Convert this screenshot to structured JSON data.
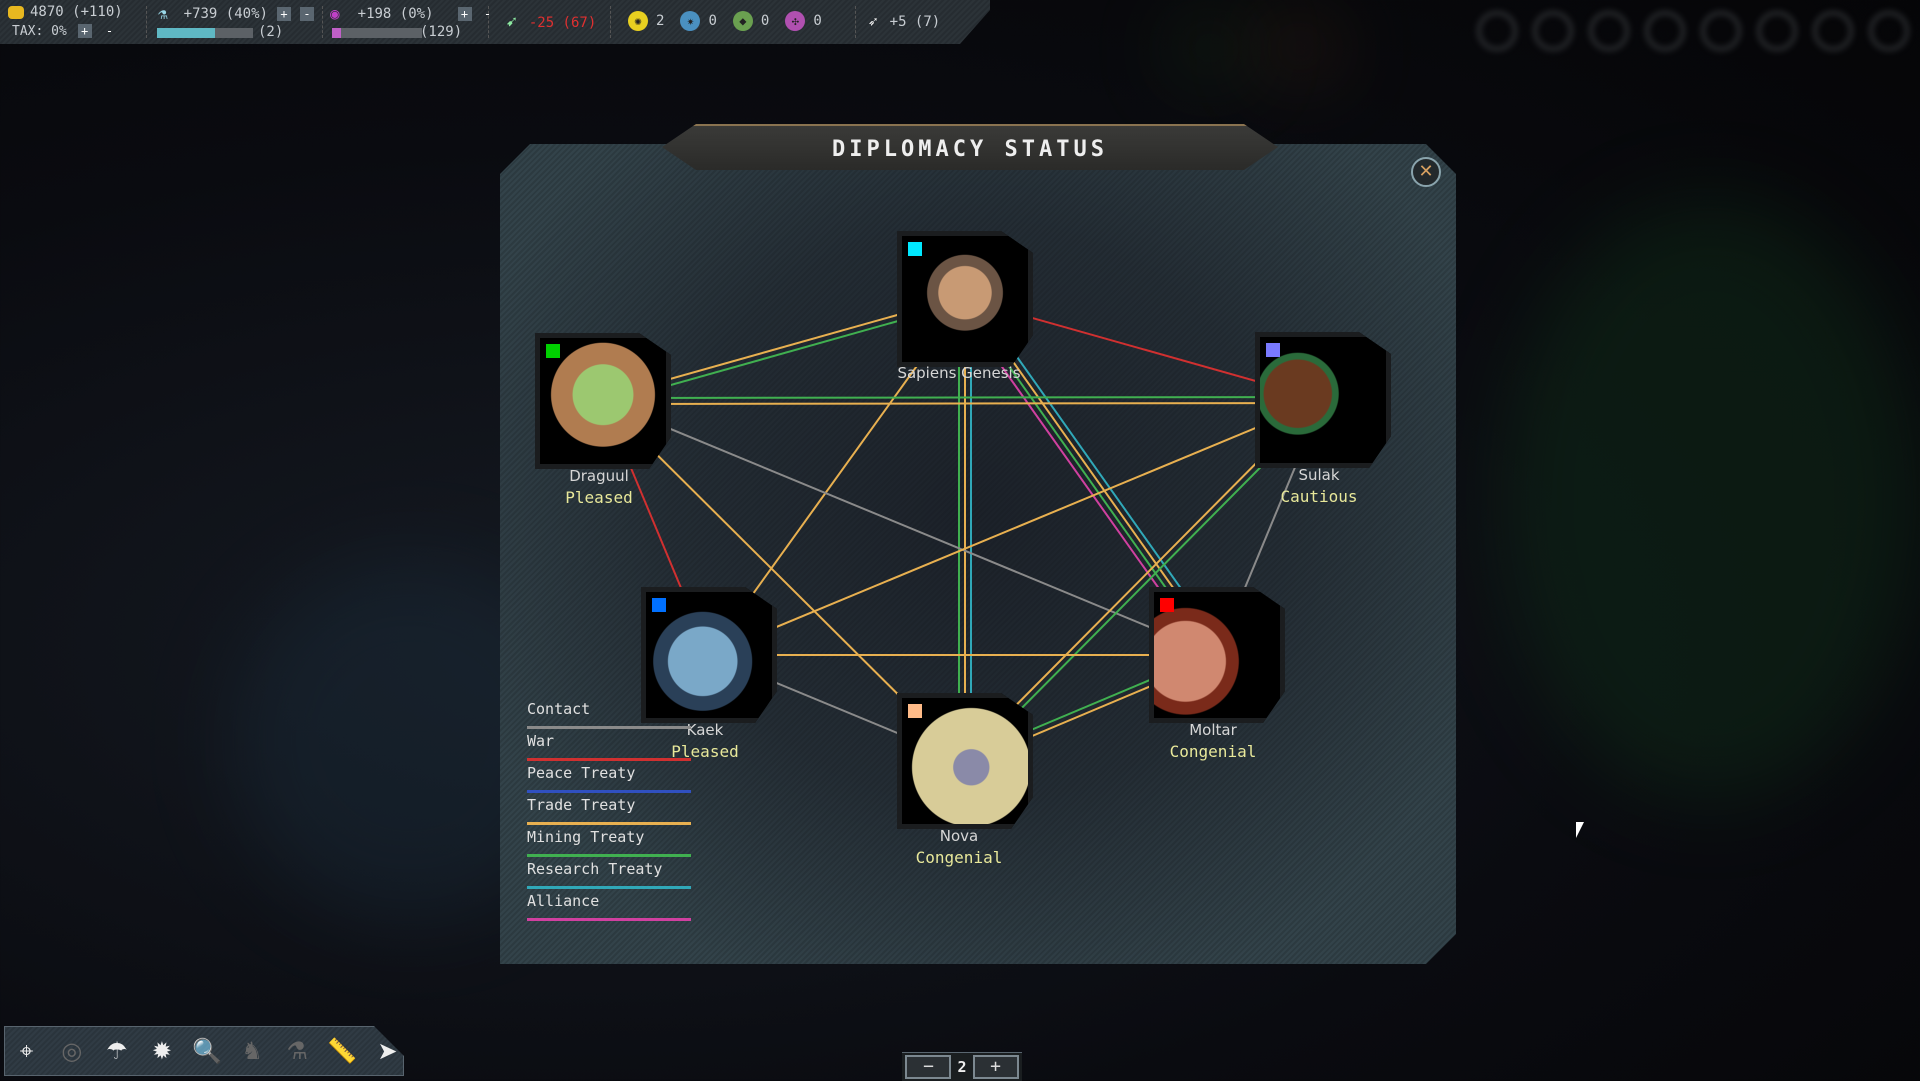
{
  "topbar": {
    "credits": {
      "icon": "credits-coin-icon",
      "value": "4870 (+110)",
      "tax_label": "TAX:",
      "tax_value": "0%",
      "plus": "+",
      "minus": "-"
    },
    "research": {
      "icon": "research-flask-icon",
      "value": "+739 (40%)",
      "count": "(2)",
      "progress": 0.6,
      "plus": "+",
      "minus": "-",
      "color": "#5fb8c4"
    },
    "influence": {
      "icon": "influence-icon",
      "value": "+198 (0%)",
      "count": "(129)",
      "progress": 0.1,
      "plus": "+",
      "minus": "-",
      "color": "#c060c8"
    },
    "command": {
      "icon": "command-ship-icon",
      "value": "-25 (67)",
      "color": "#e03030"
    },
    "strategic": [
      {
        "icon": "atom-resource-icon",
        "value": "2",
        "color": "#e8d020"
      },
      {
        "icon": "crystal-burst-resource-icon",
        "value": "0",
        "color": "#4a90c0"
      },
      {
        "icon": "gem-resource-icon",
        "value": "0",
        "color": "#6aa050"
      },
      {
        "icon": "molecule-resource-icon",
        "value": "0",
        "color": "#b050b0"
      }
    ],
    "fleet": {
      "icon": "fleet-supply-icon",
      "value": "+5 (7)"
    }
  },
  "dialog": {
    "title": "DIPLOMACY STATUS",
    "close_icon": "close-icon"
  },
  "empires": [
    {
      "id": "sapiens",
      "name": "Sapiens Genesis",
      "status": "",
      "color": "#00e8ff"
    },
    {
      "id": "draguul",
      "name": "Draguul",
      "status": "Pleased",
      "color": "#00d000"
    },
    {
      "id": "sulak",
      "name": "Sulak",
      "status": "Cautious",
      "color": "#7a7aff"
    },
    {
      "id": "kaek",
      "name": "Kaek",
      "status": "Pleased",
      "color": "#0070ff"
    },
    {
      "id": "moltar",
      "name": "Moltar",
      "status": "Congenial",
      "color": "#ff0000"
    },
    {
      "id": "nova",
      "name": "Nova",
      "status": "Congenial",
      "color": "#ffbb88"
    }
  ],
  "relations": [
    {
      "a": "sapiens",
      "b": "draguul",
      "types": [
        "mining",
        "trade"
      ]
    },
    {
      "a": "sapiens",
      "b": "sulak",
      "types": [
        "war"
      ]
    },
    {
      "a": "sapiens",
      "b": "kaek",
      "types": [
        "trade"
      ]
    },
    {
      "a": "sapiens",
      "b": "nova",
      "types": [
        "research",
        "trade",
        "mining"
      ]
    },
    {
      "a": "sapiens",
      "b": "moltar",
      "types": [
        "research",
        "trade",
        "mining",
        "alliance"
      ]
    },
    {
      "a": "draguul",
      "b": "sulak",
      "types": [
        "mining",
        "trade"
      ]
    },
    {
      "a": "draguul",
      "b": "kaek",
      "types": [
        "war"
      ]
    },
    {
      "a": "draguul",
      "b": "nova",
      "types": [
        "trade"
      ]
    },
    {
      "a": "draguul",
      "b": "moltar",
      "types": [
        "contact"
      ]
    },
    {
      "a": "sulak",
      "b": "kaek",
      "types": [
        "trade"
      ]
    },
    {
      "a": "sulak",
      "b": "nova",
      "types": [
        "mining",
        "trade"
      ]
    },
    {
      "a": "sulak",
      "b": "moltar",
      "types": [
        "contact"
      ]
    },
    {
      "a": "kaek",
      "b": "moltar",
      "types": [
        "trade"
      ]
    },
    {
      "a": "kaek",
      "b": "nova",
      "types": [
        "contact"
      ]
    },
    {
      "a": "nova",
      "b": "moltar",
      "types": [
        "mining",
        "trade"
      ]
    }
  ],
  "legend": [
    {
      "key": "contact",
      "label": "Contact",
      "color": "#8a8a8a"
    },
    {
      "key": "war",
      "label": "War",
      "color": "#d03030"
    },
    {
      "key": "peace",
      "label": "Peace Treaty",
      "color": "#3050c0"
    },
    {
      "key": "trade",
      "label": "Trade Treaty",
      "color": "#e8b050"
    },
    {
      "key": "mining",
      "label": "Mining Treaty",
      "color": "#40b050"
    },
    {
      "key": "research",
      "label": "Research Treaty",
      "color": "#30a8b8"
    },
    {
      "key": "alliance",
      "label": "Alliance",
      "color": "#d040a0"
    }
  ],
  "bottombar": {
    "buttons": [
      {
        "icon": "location-pin-icon",
        "glyph": "⌖",
        "enabled": true
      },
      {
        "icon": "radar-icon",
        "glyph": "◎",
        "enabled": false
      },
      {
        "icon": "parachute-drop-icon",
        "glyph": "☂",
        "enabled": true
      },
      {
        "icon": "explosion-icon",
        "glyph": "✹",
        "enabled": true
      },
      {
        "icon": "search-icon",
        "glyph": "🔍",
        "enabled": true
      },
      {
        "icon": "chess-knight-icon",
        "glyph": "♞",
        "enabled": false
      },
      {
        "icon": "science-check-icon",
        "glyph": "⚗",
        "enabled": false
      },
      {
        "icon": "ruler-icon",
        "glyph": "📏",
        "enabled": true
      },
      {
        "icon": "next-arrow-icon",
        "glyph": "➤",
        "enabled": true
      }
    ]
  },
  "zoom": {
    "minus": "−",
    "value": "2",
    "plus": "+"
  }
}
